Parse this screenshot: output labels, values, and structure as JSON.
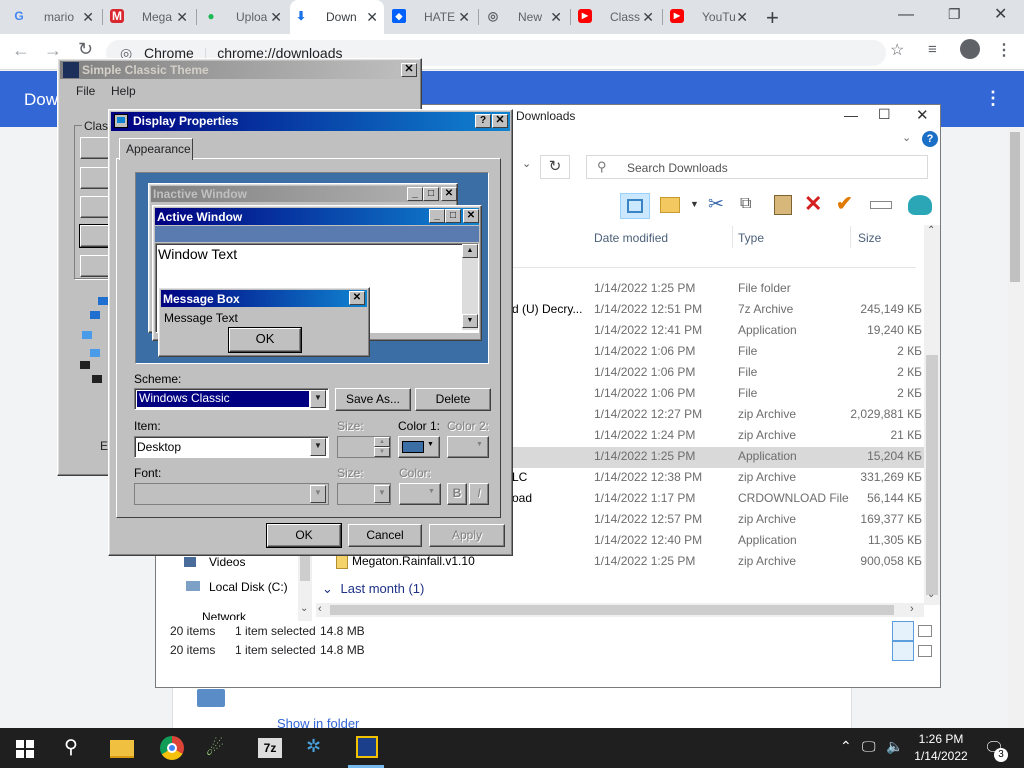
{
  "browser": {
    "tabs": [
      {
        "label": "mario",
        "icon": "google-icon"
      },
      {
        "label": "Mega",
        "icon": "mega-icon"
      },
      {
        "label": "Uploa",
        "icon": "upload-icon"
      },
      {
        "label": "Down",
        "icon": "download-icon"
      },
      {
        "label": "HATE",
        "icon": "dropbox-icon"
      },
      {
        "label": "New",
        "icon": "chrome-icon"
      },
      {
        "label": "Class",
        "icon": "youtube-icon"
      },
      {
        "label": "YouTu",
        "icon": "youtube-icon"
      }
    ],
    "omnibox_site": "Chrome",
    "omnibox_url": "chrome://downloads",
    "page_title": "Dow",
    "show_in_folder": "Show in folder",
    "accent": "#3367d6"
  },
  "explorer": {
    "title": "Downloads",
    "search_placeholder": "Search Downloads",
    "columns": [
      "Date modified",
      "Type",
      "Size"
    ],
    "rows": [
      {
        "name": "",
        "date": "1/14/2022 1:25 PM",
        "type": "File folder",
        "size": ""
      },
      {
        "name": "d (U) Decry...",
        "date": "1/14/2022 12:51 PM",
        "type": "7z Archive",
        "size": "245,149 КБ"
      },
      {
        "name": "",
        "date": "1/14/2022 12:41 PM",
        "type": "Application",
        "size": "19,240 КБ"
      },
      {
        "name": "",
        "date": "1/14/2022 1:06 PM",
        "type": "File",
        "size": "2 КБ"
      },
      {
        "name": "",
        "date": "1/14/2022 1:06 PM",
        "type": "File",
        "size": "2 КБ"
      },
      {
        "name": "",
        "date": "1/14/2022 1:06 PM",
        "type": "File",
        "size": "2 КБ"
      },
      {
        "name": "",
        "date": "1/14/2022 12:27 PM",
        "type": "zip Archive",
        "size": "2,029,881 КБ"
      },
      {
        "name": "",
        "date": "1/14/2022 1:24 PM",
        "type": "zip Archive",
        "size": "21 КБ"
      },
      {
        "name": "",
        "date": "1/14/2022 1:25 PM",
        "type": "Application",
        "size": "15,204 КБ"
      },
      {
        "name": "LC",
        "date": "1/14/2022 12:38 PM",
        "type": "zip Archive",
        "size": "331,269 КБ"
      },
      {
        "name": "oad",
        "date": "1/14/2022 1:17 PM",
        "type": "CRDOWNLOAD File",
        "size": "56,144 КБ"
      },
      {
        "name": "",
        "date": "1/14/2022 12:57 PM",
        "type": "zip Archive",
        "size": "169,377 КБ"
      },
      {
        "name": "",
        "date": "1/14/2022 12:40 PM",
        "type": "Application",
        "size": "11,305 КБ"
      },
      {
        "name": "Megaton.Rainfall.v1.10",
        "date": "1/14/2022 1:25 PM",
        "type": "zip Archive",
        "size": "900,058 КБ"
      }
    ],
    "group_label": "Last month (1)",
    "nav": [
      "Videos",
      "Local Disk (C:)",
      "Network"
    ],
    "status": [
      {
        "count": "20 items",
        "selected": "1 item selected",
        "size": "14.8 MB"
      },
      {
        "count": "20 items",
        "selected": "1 item selected",
        "size": "14.8 MB"
      }
    ]
  },
  "sct": {
    "title": "Simple Classic Theme",
    "menu": [
      "File",
      "Help"
    ],
    "group": "Class",
    "fragment": "Ex"
  },
  "display": {
    "title": "Display Properties",
    "tab": "Appearance",
    "preview": {
      "inactive": "Inactive Window",
      "active": "Active Window",
      "window_text": "Window Text",
      "msgbox_title": "Message Box",
      "msgbox_text": "Message Text",
      "ok": "OK"
    },
    "scheme_label": "Scheme:",
    "scheme_value": "Windows Classic",
    "save_as": "Save As...",
    "delete": "Delete",
    "item_label": "Item:",
    "item_value": "Desktop",
    "size_label": "Size:",
    "color1_label": "Color 1:",
    "color2_label": "Color 2:",
    "font_label": "Font:",
    "font_size_label": "Size:",
    "font_color_label": "Color:",
    "bold": "B",
    "italic": "I",
    "ok": "OK",
    "cancel": "Cancel",
    "apply": "Apply",
    "color1_value": "#3a6ea5"
  },
  "taskbar": {
    "time": "1:26 PM",
    "date": "1/14/2022",
    "notifications": "3"
  }
}
